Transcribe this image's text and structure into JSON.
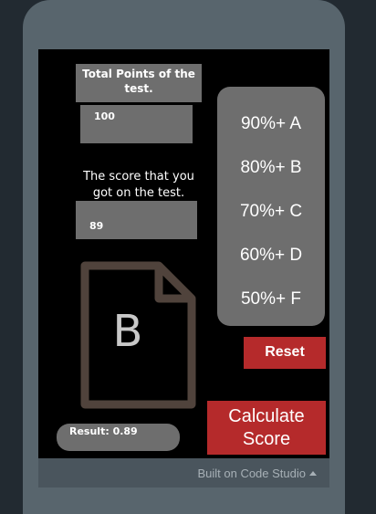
{
  "total_points": {
    "label": "Total Points of the test.",
    "value": "100"
  },
  "score": {
    "label": "The score that you got on the test.",
    "value": "89"
  },
  "grade_scale": [
    "90%+ A",
    "80%+ B",
    "70%+ C",
    "60%+ D",
    "50%+ F"
  ],
  "reset_label": "Reset",
  "calculate_label": "Calculate Score",
  "grade_letter": "B",
  "result_text": "Result: 0.89",
  "footer_text": "Built on Code Studio",
  "colors": {
    "accent_red": "#b52a2b",
    "panel_gray": "#6e6e6e",
    "document_brown": "#50433c"
  }
}
